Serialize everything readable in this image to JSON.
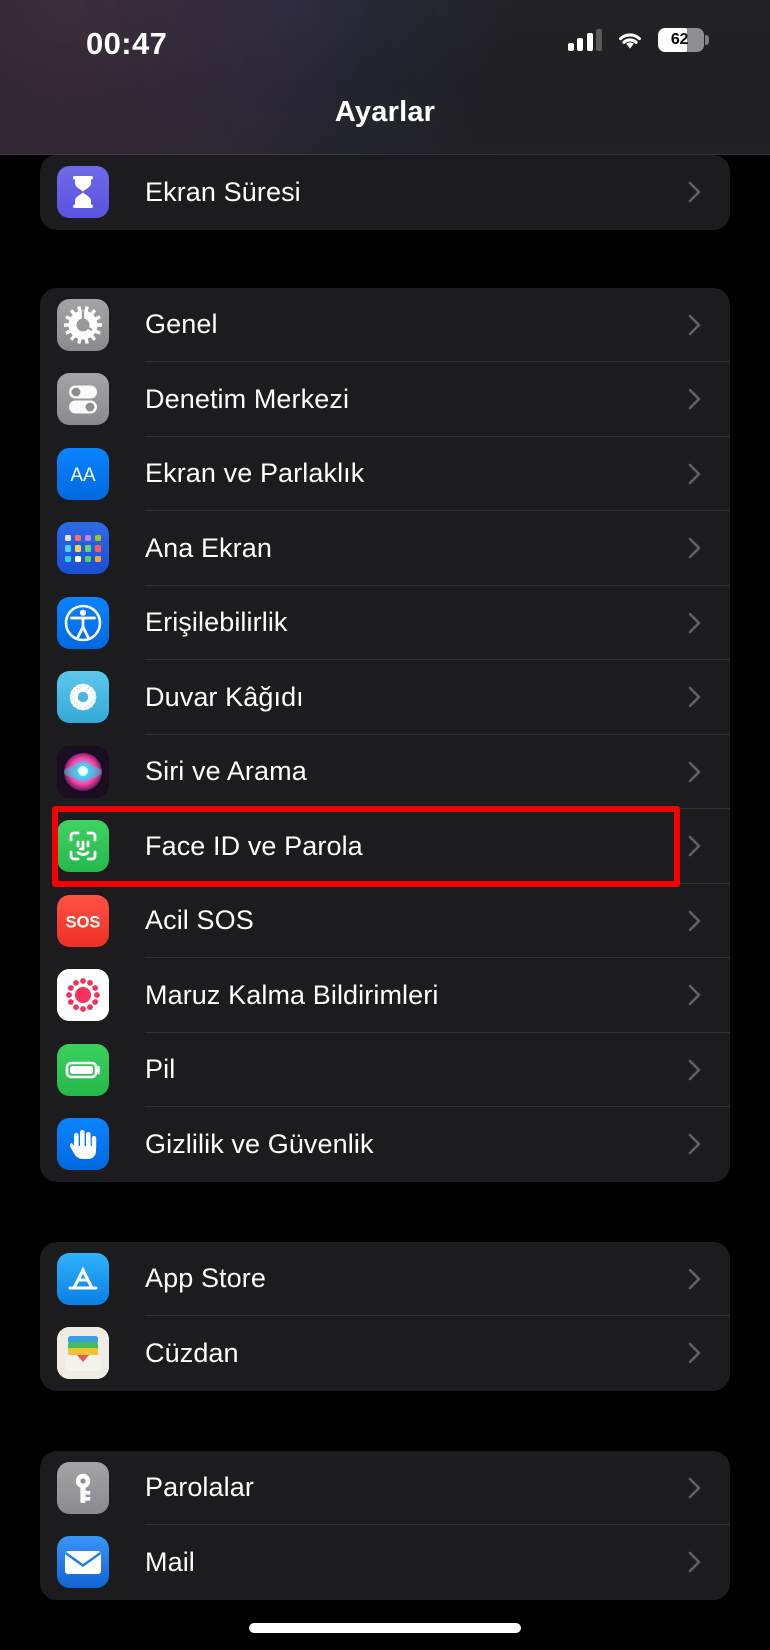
{
  "status_bar": {
    "time": "00:47",
    "signal_icon": "cellular-signal-icon",
    "signal_bars_filled": 3,
    "signal_bars_total": 4,
    "wifi_icon": "wifi-icon",
    "battery_percent": "62",
    "battery_level": 62,
    "battery_icon": "battery-icon"
  },
  "nav": {
    "title": "Ayarlar"
  },
  "highlight": {
    "color": "#f50000",
    "target": "Face ID ve Parola"
  },
  "sections": [
    {
      "name": "screen-time-section",
      "rows": [
        {
          "label": "Ekran Süresi",
          "icon": "hourglass-icon",
          "icon_color": "#5e5ce6"
        }
      ]
    },
    {
      "name": "system-section",
      "rows": [
        {
          "label": "Genel",
          "icon": "gear-icon",
          "icon_color": "#8e8e93"
        },
        {
          "label": "Denetim Merkezi",
          "icon": "control-center-icon",
          "icon_color": "#8e8e93"
        },
        {
          "label": "Ekran ve Parlaklık",
          "icon": "display-brightness-icon",
          "icon_color": "#007aff"
        },
        {
          "label": "Ana Ekran",
          "icon": "home-screen-grid-icon",
          "icon_color": "#1b4fd4"
        },
        {
          "label": "Erişilebilirlik",
          "icon": "accessibility-icon",
          "icon_color": "#007aff"
        },
        {
          "label": "Duvar Kâğıdı",
          "icon": "wallpaper-icon",
          "icon_color": "#44b9e6"
        },
        {
          "label": "Siri ve Arama",
          "icon": "siri-icon",
          "icon_color": "#2c2c2e"
        },
        {
          "label": "Face ID ve Parola",
          "icon": "face-id-icon",
          "icon_color": "#32cd55",
          "highlighted": true
        },
        {
          "label": "Acil SOS",
          "icon": "sos-icon",
          "icon_color": "#ff3b30"
        },
        {
          "label": "Maruz Kalma Bildirimleri",
          "icon": "exposure-notifications-icon",
          "icon_color": "#ffffff"
        },
        {
          "label": "Pil",
          "icon": "battery-settings-icon",
          "icon_color": "#34c759"
        },
        {
          "label": "Gizlilik ve Güvenlik",
          "icon": "privacy-hand-icon",
          "icon_color": "#007aff"
        }
      ]
    },
    {
      "name": "store-section",
      "rows": [
        {
          "label": "App Store",
          "icon": "app-store-icon",
          "icon_color": "#1aa3f5"
        },
        {
          "label": "Cüzdan",
          "icon": "wallet-icon",
          "icon_color": "#e9e7e2"
        }
      ]
    },
    {
      "name": "apps-section",
      "rows": [
        {
          "label": "Parolalar",
          "icon": "key-icon",
          "icon_color": "#8e8e93"
        },
        {
          "label": "Mail",
          "icon": "mail-icon",
          "icon_color": "#1a7cf0"
        }
      ]
    }
  ]
}
